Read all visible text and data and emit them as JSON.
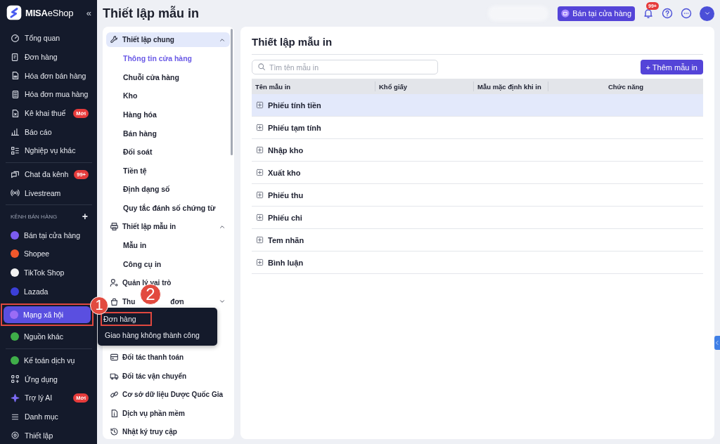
{
  "sidebar": {
    "logo": {
      "brand": "MISA",
      "product": "eShop"
    },
    "collapse": "«",
    "sections": [
      {
        "items": [
          {
            "label": "Tổng quan",
            "selected": false
          },
          {
            "label": "Đơn hàng",
            "selected": false
          },
          {
            "label": "Hóa đơn bán hàng",
            "selected": false
          },
          {
            "label": "Hóa đơn mua hàng",
            "selected": false
          },
          {
            "label": "Kê khai thuế",
            "badge": "Mới",
            "selected": false
          },
          {
            "label": "Báo cáo",
            "selected": false
          },
          {
            "label": "Nghiệp vụ khác",
            "selected": false
          }
        ]
      },
      {
        "items": [
          {
            "label": "Chat đa kênh",
            "badge": "99+",
            "selected": false
          },
          {
            "label": "Livestream",
            "selected": false
          }
        ]
      },
      {
        "heading": "KÊNH BÁN HÀNG",
        "add": "+",
        "items": [
          {
            "label": "Bán tại cửa hàng",
            "color": "#7b5cf0",
            "selected": false
          },
          {
            "label": "Shopee",
            "color": "#f1582c",
            "selected": false
          },
          {
            "label": "TikTok Shop",
            "color": "#f2f2f2",
            "selected": false
          },
          {
            "label": "Lazada",
            "color": "#3b3fd8",
            "selected": false
          },
          {
            "label": "Mạng xã hội",
            "color": "#9b6cf5",
            "selected": true,
            "marker": "1"
          },
          {
            "label": "Nguồn khác",
            "color": "#3fae49",
            "selected": false
          }
        ]
      },
      {
        "items": [
          {
            "label": "Kế toán dịch vụ",
            "selected": false
          },
          {
            "label": "Ứng dụng",
            "selected": false
          },
          {
            "label": "Trợ lý AI",
            "badge": "Mới",
            "selected": false
          },
          {
            "label": "Danh mục",
            "selected": false
          },
          {
            "label": "Thiết lập",
            "selected": false
          }
        ]
      }
    ]
  },
  "header": {
    "title": "Thiết lập mẫu in",
    "store_button": "Bán tại cửa hàng",
    "notification_badge": "99+"
  },
  "settings_menu": [
    {
      "label": "Thiết lập chung",
      "selected": true,
      "expanded": true,
      "children": [
        {
          "label": "Thông tin cửa hàng",
          "selected": true
        },
        {
          "label": "Chuỗi cửa hàng",
          "selected": false
        },
        {
          "label": "Kho",
          "selected": false
        },
        {
          "label": "Hàng hóa",
          "selected": false
        },
        {
          "label": "Bán hàng",
          "selected": false
        },
        {
          "label": "Đối soát",
          "selected": false
        },
        {
          "label": "Tiền tệ",
          "selected": false
        },
        {
          "label": "Định dạng số",
          "selected": false
        },
        {
          "label": "Quy tắc đánh số chứng từ",
          "selected": false
        }
      ]
    },
    {
      "label": "Thiết lập mẫu in",
      "selected": false,
      "expanded": true,
      "children": [
        {
          "label": "Mẫu in",
          "selected": false
        },
        {
          "label": "Công cụ in",
          "selected": false
        }
      ]
    },
    {
      "label": "Quản lý vai trò",
      "selected": false
    },
    {
      "label": "Thu",
      "label_end": "đơn",
      "selected": false,
      "expanded": false
    },
    {
      "label": "Đối tác thanh toán",
      "selected": false
    },
    {
      "label": "Đối tác vận chuyển",
      "selected": false
    },
    {
      "label": "Cơ sở dữ liệu Dược Quốc Gia",
      "selected": false
    },
    {
      "label": "Dịch vụ phần mềm",
      "selected": false
    },
    {
      "label": "Nhật ký truy cập",
      "selected": false
    }
  ],
  "popup_menu": {
    "marker": "2",
    "items": [
      {
        "label": "Đơn hàng",
        "outlined": true
      },
      {
        "label": "Giao hàng không thành công",
        "outlined": false
      }
    ]
  },
  "content": {
    "title": "Thiết lập mẫu in",
    "search": {
      "placeholder": "Tìm tên mẫu in"
    },
    "add_button": "+ Thêm mẫu in",
    "table": {
      "columns": [
        "Tên mẫu in",
        "Khổ giấy",
        "Mẫu mặc định khi in",
        "Chức năng"
      ],
      "rows": [
        {
          "name": "Phiếu tính tiền",
          "selected": true
        },
        {
          "name": "Phiếu tạm tính",
          "selected": false
        },
        {
          "name": "Nhập kho",
          "selected": false
        },
        {
          "name": "Xuất kho",
          "selected": false
        },
        {
          "name": "Phiếu thu",
          "selected": false
        },
        {
          "name": "Phiếu chi",
          "selected": false
        },
        {
          "name": "Tem nhãn",
          "selected": false
        },
        {
          "name": "Bình luận",
          "selected": false
        }
      ]
    }
  }
}
